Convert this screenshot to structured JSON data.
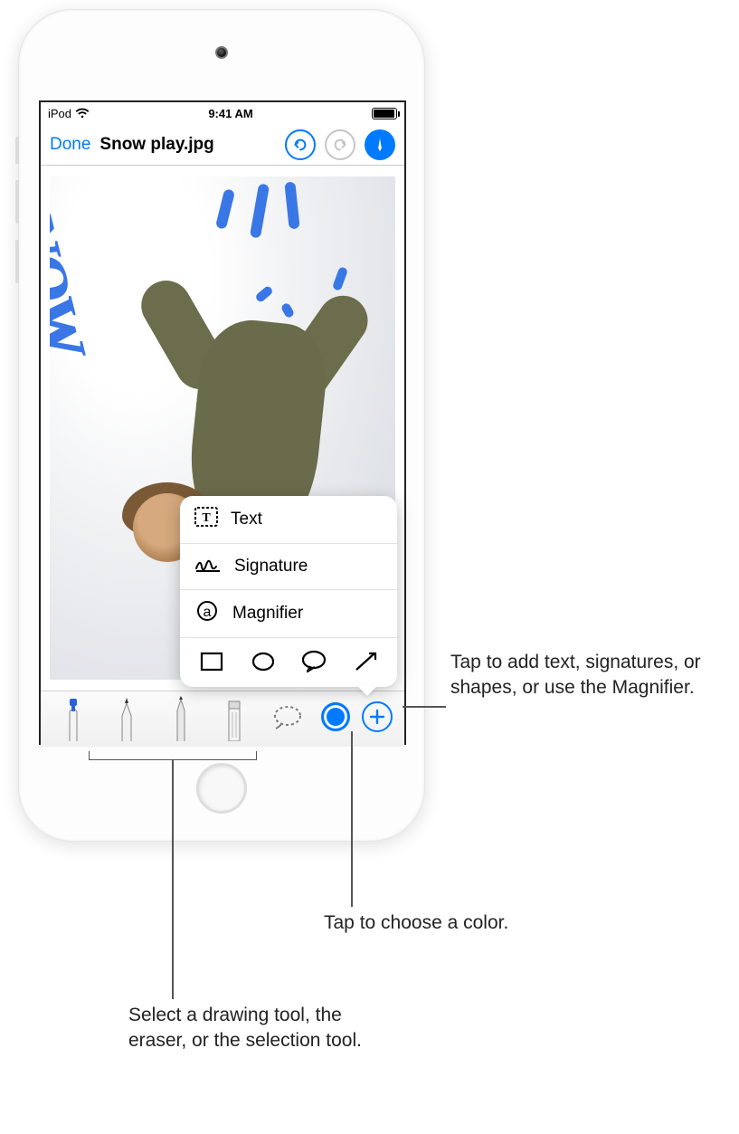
{
  "status": {
    "carrier": "iPod",
    "time": "9:41 AM"
  },
  "nav": {
    "done": "Done",
    "title": "Snow play.jpg"
  },
  "canvas": {
    "handwritten": "SNOW"
  },
  "popover": {
    "text_label": "Text",
    "signature_label": "Signature",
    "magnifier_label": "Magnifier"
  },
  "callouts": {
    "add": "Tap to add text, signatures, or shapes, or use the Magnifier.",
    "color": "Tap to choose a color.",
    "tools": "Select a drawing tool, the eraser, or the selection tool."
  }
}
